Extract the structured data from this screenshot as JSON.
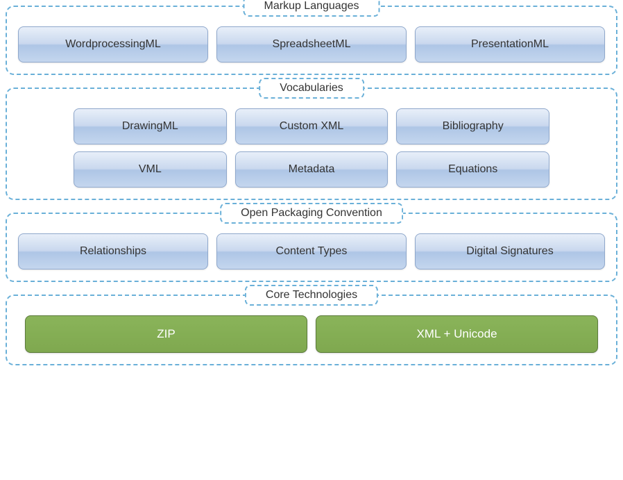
{
  "sections": {
    "markup": {
      "title": "Markup Languages",
      "items": [
        "WordprocessingML",
        "SpreadsheetML",
        "PresentationML"
      ]
    },
    "vocab": {
      "title": "Vocabularies",
      "row1": [
        "DrawingML",
        "Custom XML",
        "Bibliography"
      ],
      "row2": [
        "VML",
        "Metadata",
        "Equations"
      ]
    },
    "opc": {
      "title": "Open Packaging Convention",
      "items": [
        "Relationships",
        "Content Types",
        "Digital Signatures"
      ]
    },
    "core": {
      "title": "Core Technologies",
      "items": [
        "ZIP",
        "XML + Unicode"
      ]
    }
  }
}
